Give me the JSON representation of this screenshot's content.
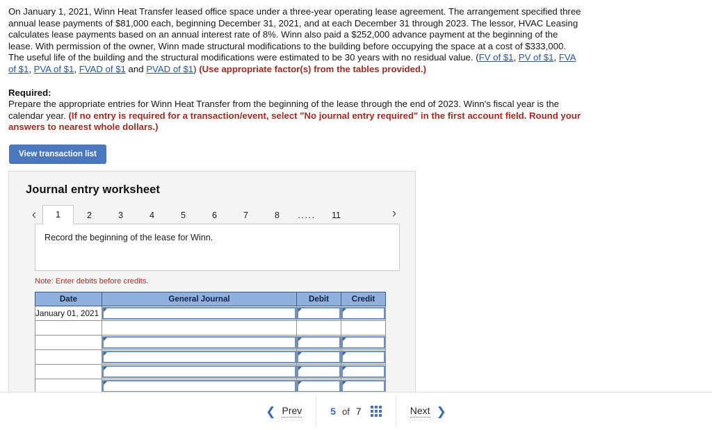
{
  "question": {
    "paragraph_parts": [
      {
        "type": "text",
        "value": "On January 1, 2021, Winn Heat Transfer leased office space under a three-year operating lease agreement. The arrangement specified three annual lease payments of $81,000 each, beginning December 31, 2021, and at each December 31 through 2023. The lessor, HVAC Leasing calculates lease payments based on an annual interest rate of 8%. Winn also paid a $252,000 advance payment at the beginning of the lease. With permission of the owner, Winn made structural modifications to the building before occupying the space at a cost of $333,000. The useful life of the building and the structural modifications were estimated to be 30 years with no residual value. ("
      },
      {
        "type": "link",
        "value": "FV of $1"
      },
      {
        "type": "text",
        "value": ", "
      },
      {
        "type": "link",
        "value": "PV of $1"
      },
      {
        "type": "text",
        "value": ", "
      },
      {
        "type": "link",
        "value": "FVA of $1"
      },
      {
        "type": "text",
        "value": ", "
      },
      {
        "type": "link",
        "value": "PVA of $1"
      },
      {
        "type": "text",
        "value": ", "
      },
      {
        "type": "link",
        "value": "FVAD of $1"
      },
      {
        "type": "text",
        "value": " and "
      },
      {
        "type": "link",
        "value": "PVAD of $1"
      },
      {
        "type": "text",
        "value": ") "
      },
      {
        "type": "emph",
        "value": "(Use appropriate factor(s) from the tables provided.)"
      }
    ]
  },
  "required": {
    "label": "Required:",
    "parts": [
      {
        "type": "text",
        "value": "Prepare the appropriate entries for Winn Heat Transfer from the beginning of the lease through the end of 2023. Winn's fiscal year is the calendar year. "
      },
      {
        "type": "emph",
        "value": "(If no entry is required for a transaction/event, select \"No journal entry required\" in the first account field. Round your answers to nearest whole dollars.)"
      }
    ]
  },
  "toolbar": {
    "view_transaction_list_label": "View transaction list"
  },
  "worksheet": {
    "title": "Journal entry worksheet",
    "tabs": [
      "1",
      "2",
      "3",
      "4",
      "5",
      "6",
      "7",
      "8"
    ],
    "tab_ellipsis": ".....",
    "tab_last": "11",
    "active_tab": "1",
    "prev_arrow_icon": "chevron-left-icon",
    "next_arrow_icon": "chevron-right-icon",
    "instruction": "Record the beginning of the lease for Winn.",
    "note": "Note: Enter debits before credits.",
    "table": {
      "columns": [
        "Date",
        "General Journal",
        "Debit",
        "Credit"
      ],
      "rows": [
        {
          "date": "January 01, 2021",
          "general_journal": "",
          "debit": "",
          "credit": ""
        },
        {
          "date": "",
          "general_journal": "",
          "debit": "",
          "credit": ""
        },
        {
          "date": "",
          "general_journal": "",
          "debit": "",
          "credit": ""
        },
        {
          "date": "",
          "general_journal": "",
          "debit": "",
          "credit": ""
        },
        {
          "date": "",
          "general_journal": "",
          "debit": "",
          "credit": ""
        },
        {
          "date": "",
          "general_journal": "",
          "debit": "",
          "credit": ""
        }
      ]
    }
  },
  "pager": {
    "prev_label": "Prev",
    "next_label": "Next",
    "current_page": "5",
    "of_label": "of",
    "total_pages": "7",
    "grid_icon": "grid-view-icon",
    "prev_icon": "chevron-left-icon",
    "next_icon": "chevron-right-icon"
  },
  "colors": {
    "accent_blue": "#4a77bd",
    "link_blue": "#2a5699",
    "emphasis_red": "#a32b22",
    "table_header_blue": "#92b0dd",
    "input_border_blue": "#6d90c4",
    "panel_bg": "#f4f4f4"
  }
}
